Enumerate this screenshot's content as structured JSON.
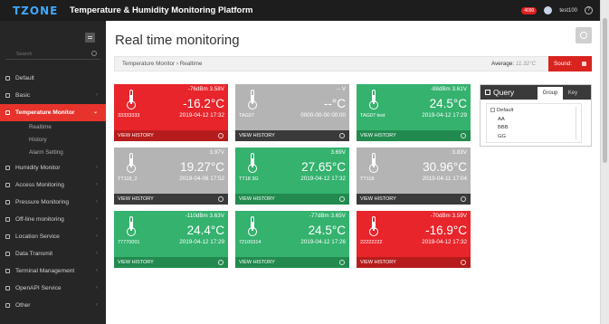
{
  "topbar": {
    "logo": "TZONE",
    "title": "Temperature & Humidity Monitoring Platform",
    "alarm_badge": "4090",
    "user": "test100"
  },
  "sidebar": {
    "search_placeholder": "Search",
    "items": [
      {
        "label": "Default",
        "icon": "home-icon",
        "chevron": false
      },
      {
        "label": "Basic",
        "icon": "user-icon",
        "chevron": true
      },
      {
        "label": "Temperature Monitor",
        "icon": "thermometer-icon",
        "chevron": true,
        "active": true,
        "children": [
          "Realtime",
          "History",
          "Alarm Setting"
        ]
      },
      {
        "label": "Humidity Monitor",
        "icon": "droplet-icon",
        "chevron": true
      },
      {
        "label": "Access Monitoring",
        "icon": "lock-icon",
        "chevron": true
      },
      {
        "label": "Pressure Monitoring",
        "icon": "gauge-icon",
        "chevron": true
      },
      {
        "label": "Off-line monitoring",
        "icon": "wifi-off-icon",
        "chevron": true
      },
      {
        "label": "Location Service",
        "icon": "location-icon",
        "chevron": true
      },
      {
        "label": "Data Transmit",
        "icon": "transmit-icon",
        "chevron": true
      },
      {
        "label": "Terminal Management",
        "icon": "terminal-icon",
        "chevron": true
      },
      {
        "label": "OpenAPI Service",
        "icon": "api-icon",
        "chevron": true
      },
      {
        "label": "Other",
        "icon": "other-icon",
        "chevron": true
      }
    ]
  },
  "main": {
    "title": "Real time monitoring",
    "breadcrumb": "Temperature Monitor › Realtime",
    "average_label": "Average:",
    "average_value": "11.32°C",
    "sound_label": "Sound:"
  },
  "cards": [
    {
      "color": "red",
      "head": "-76dBm 3.58V",
      "temp": "-16.2°C",
      "name": "33333333",
      "time": "2019-04-12 17:32",
      "footer": "VIEW HISTORY"
    },
    {
      "color": "gray",
      "head": "-- V",
      "temp": "--°C",
      "name": "TAG07",
      "time": "0000-00-00 00:00",
      "footer": "VIEW HISTORY"
    },
    {
      "color": "green",
      "head": "-88dBm 3.61V",
      "temp": "24.5°C",
      "name": "TAG07 test",
      "time": "2019-04-12 17:29",
      "footer": "VIEW HISTORY"
    },
    {
      "color": "gray",
      "head": "3.97V",
      "temp": "19.27°C",
      "name": "TT118_2",
      "time": "2019-04-08 17:52",
      "footer": "VIEW HISTORY"
    },
    {
      "color": "green",
      "head": "3.69V",
      "temp": "27.65°C",
      "name": "TT18 3G",
      "time": "2019-04-12 17:32",
      "footer": "VIEW HISTORY"
    },
    {
      "color": "gray",
      "head": "3.83V",
      "temp": "30.96°C",
      "name": "TT118",
      "time": "2019-04-11 17:04",
      "footer": "VIEW HISTORY"
    },
    {
      "color": "green",
      "head": "-110dBm 3.63V",
      "temp": "24.4°C",
      "name": "77770001",
      "time": "2019-04-12 17:29",
      "footer": "VIEW HISTORY"
    },
    {
      "color": "green",
      "head": "-77dBm 3.65V",
      "temp": "24.5°C",
      "name": "72100314",
      "time": "2019-04-12 17:26",
      "footer": "VIEW HISTORY"
    },
    {
      "color": "red",
      "head": "-70dBm 3.59V",
      "temp": "-16.9°C",
      "name": "22222222",
      "time": "2019-04-12 17:32",
      "footer": "VIEW HISTORY"
    }
  ],
  "query": {
    "title": "Query",
    "tabs": [
      "Group",
      "Key"
    ],
    "tree": {
      "root": "Default",
      "children": [
        "AA",
        "BBB",
        "GG"
      ]
    }
  },
  "colors": {
    "red": "#e7252b",
    "green": "#34b26e",
    "gray": "#b4b4b4",
    "sidebar": "#262626",
    "accent": "#e7332c"
  }
}
